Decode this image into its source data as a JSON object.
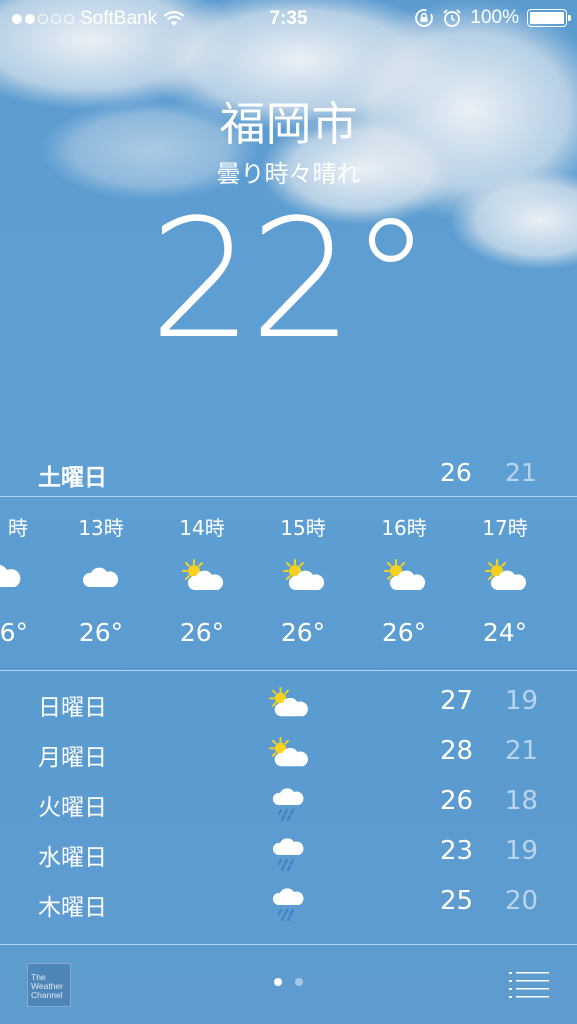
{
  "status_bar": {
    "carrier": "SoftBank",
    "signal_bars_filled": 2,
    "signal_bars_total": 5,
    "time": "7:35",
    "battery": "100%"
  },
  "location": {
    "city": "福岡市",
    "condition": "曇り時々晴れ",
    "temperature": "22°"
  },
  "today": {
    "day": "土曜日",
    "high": "26",
    "low": "21"
  },
  "hourly": [
    {
      "time": "時",
      "icon": "cloud-icon",
      "temp": "6°"
    },
    {
      "time": "13時",
      "icon": "cloud-icon",
      "temp": "26°"
    },
    {
      "time": "14時",
      "icon": "partly-sunny-icon",
      "temp": "26°"
    },
    {
      "time": "15時",
      "icon": "partly-sunny-icon",
      "temp": "26°"
    },
    {
      "time": "16時",
      "icon": "partly-sunny-icon",
      "temp": "26°"
    },
    {
      "time": "17時",
      "icon": "partly-sunny-icon",
      "temp": "24°"
    }
  ],
  "daily": [
    {
      "day": "日曜日",
      "icon": "partly-sunny-icon",
      "high": "27",
      "low": "19"
    },
    {
      "day": "月曜日",
      "icon": "partly-sunny-icon",
      "high": "28",
      "low": "21"
    },
    {
      "day": "火曜日",
      "icon": "rain-icon",
      "high": "26",
      "low": "18"
    },
    {
      "day": "水曜日",
      "icon": "rain-icon",
      "high": "23",
      "low": "19"
    },
    {
      "day": "木曜日",
      "icon": "rain-icon",
      "high": "25",
      "low": "20"
    }
  ],
  "footer": {
    "logo_text": "The Weather Channel",
    "page_count": 2,
    "active_page": 0
  },
  "colors": {
    "sun": "#f6d21e",
    "low_temp": "#b9d4ec",
    "rain": "#3f7fc4"
  }
}
